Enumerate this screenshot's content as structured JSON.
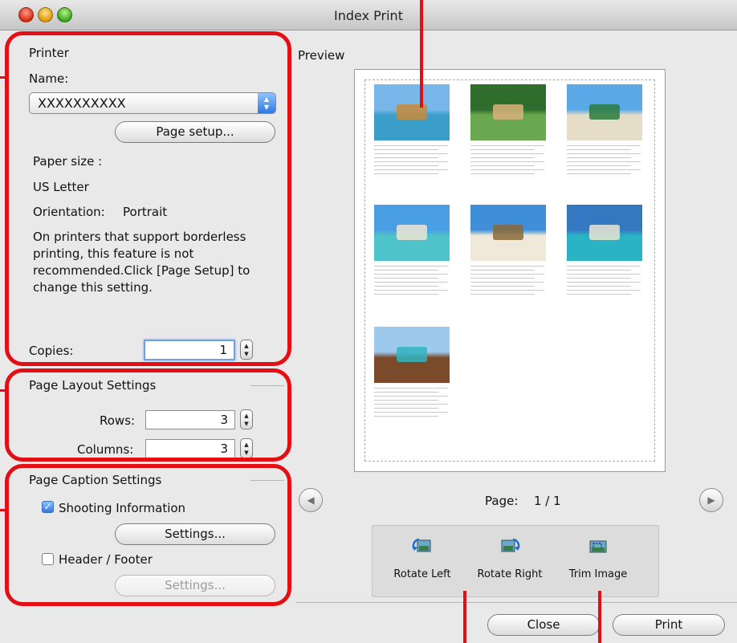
{
  "window": {
    "title": "Index Print"
  },
  "printer": {
    "group_title": "Printer",
    "name_label": "Name:",
    "name_value": "XXXXXXXXXX",
    "page_setup_button": "Page setup...",
    "paper_size_label": "Paper size :",
    "paper_size_value": "US Letter",
    "orientation_label": "Orientation:",
    "orientation_value": "Portrait",
    "notice_lines": [
      "On printers that support borderless",
      "printing, this feature is not",
      "recommended.Click [Page Setup] to",
      "change this setting."
    ],
    "copies_label": "Copies:",
    "copies_value": "1"
  },
  "layout": {
    "group_title": "Page Layout Settings",
    "rows_label": "Rows:",
    "rows_value": "3",
    "columns_label": "Columns:",
    "columns_value": "3"
  },
  "caption": {
    "group_title": "Page Caption Settings",
    "shooting_info_label": "Shooting Information",
    "shooting_info_checked": true,
    "settings_button": "Settings...",
    "header_footer_label": "Header / Footer",
    "header_footer_checked": false,
    "settings_button_disabled": "Settings..."
  },
  "preview": {
    "label": "Preview",
    "page_label": "Page:",
    "page_value": "1 / 1",
    "thumbnails": [
      {
        "name": "thumbnail-boat-pier",
        "sky": "#79b7ea",
        "ground": "#3a9ec9",
        "accent": "#c98a3b"
      },
      {
        "name": "thumbnail-jungle-palm",
        "sky": "#2e6d2b",
        "ground": "#6aa84f",
        "accent": "#d9b27a"
      },
      {
        "name": "thumbnail-beach-palm",
        "sky": "#5aa9e6",
        "ground": "#e6ddc8",
        "accent": "#2c7a3d"
      },
      {
        "name": "thumbnail-lagoon-shore",
        "sky": "#4a9ee3",
        "ground": "#4ec3c9",
        "accent": "#efe6d2"
      },
      {
        "name": "thumbnail-beach-umbrella",
        "sky": "#3f8fd8",
        "ground": "#f0e8d8",
        "accent": "#8a6a3b"
      },
      {
        "name": "thumbnail-ocean-horizon",
        "sky": "#3578c2",
        "ground": "#29b3c4",
        "accent": "#e9e4d3"
      },
      {
        "name": "thumbnail-water-bungalows",
        "sky": "#9cc9ec",
        "ground": "#7a4a2b",
        "accent": "#33b4c2"
      }
    ]
  },
  "toolbar": {
    "rotate_left": "Rotate Left",
    "rotate_right": "Rotate Right",
    "trim_image": "Trim Image"
  },
  "footer": {
    "close_button": "Close",
    "print_button": "Print"
  },
  "colors": {
    "callout_red": "#e30f14",
    "aqua_blue": "#2f79de"
  }
}
